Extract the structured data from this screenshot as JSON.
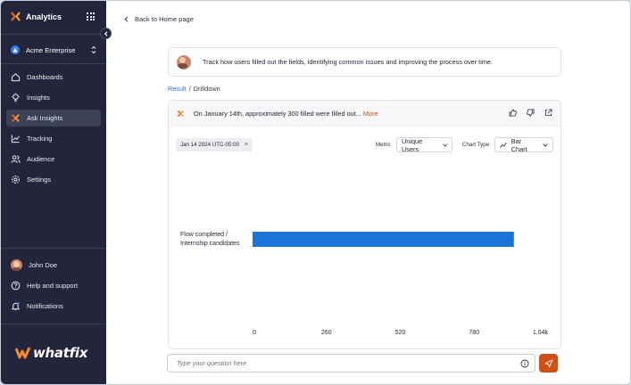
{
  "sidebar": {
    "app_name": "Analytics",
    "org_name": "Acme Enterprise",
    "nav": [
      {
        "label": "Dashboards",
        "icon": "home-icon"
      },
      {
        "label": "Insights",
        "icon": "bulb-icon"
      },
      {
        "label": "Ask Insights",
        "icon": "ask-insights-icon",
        "active": true
      },
      {
        "label": "Tracking",
        "icon": "tracking-icon"
      },
      {
        "label": "Audience",
        "icon": "audience-icon"
      },
      {
        "label": "Settings",
        "icon": "gear-icon"
      }
    ],
    "user_name": "John Doe",
    "help_label": "Help and support",
    "notifications_label": "Notifications",
    "footer_logo_text": "whatfix"
  },
  "main": {
    "back_label": "Back to Home page",
    "prompt_text": "Track how users filled out the fields, identifying common issues and improving the process over time.",
    "breadcrumb": {
      "link": "Result",
      "separator": "/",
      "current": "Drilldown"
    },
    "answer": {
      "text": "On January 14th, approximately 300 filled were filled out...",
      "more_label": "More"
    },
    "filter_chip": "Jan 14 2024 UTC-05:00",
    "metric_label": "Metric",
    "metric_value": "Unique Users",
    "chart_type_label": "Chart Type",
    "chart_type_value": "Bar Chart",
    "ask_placeholder": "Type your question here"
  },
  "colors": {
    "accent": "#cf4f16",
    "bar": "#1a73d9",
    "sidebar_bg": "#23263a",
    "link": "#2f6fd8"
  },
  "chart_data": {
    "type": "bar",
    "orientation": "horizontal",
    "categories": [
      "Flow completed / Internship candidates"
    ],
    "values": [
      920
    ],
    "xlim": [
      0,
      1040
    ],
    "x_ticks": [
      "0",
      "260",
      "520",
      "780",
      "1.04k"
    ],
    "title": "",
    "xlabel": "",
    "ylabel": ""
  }
}
